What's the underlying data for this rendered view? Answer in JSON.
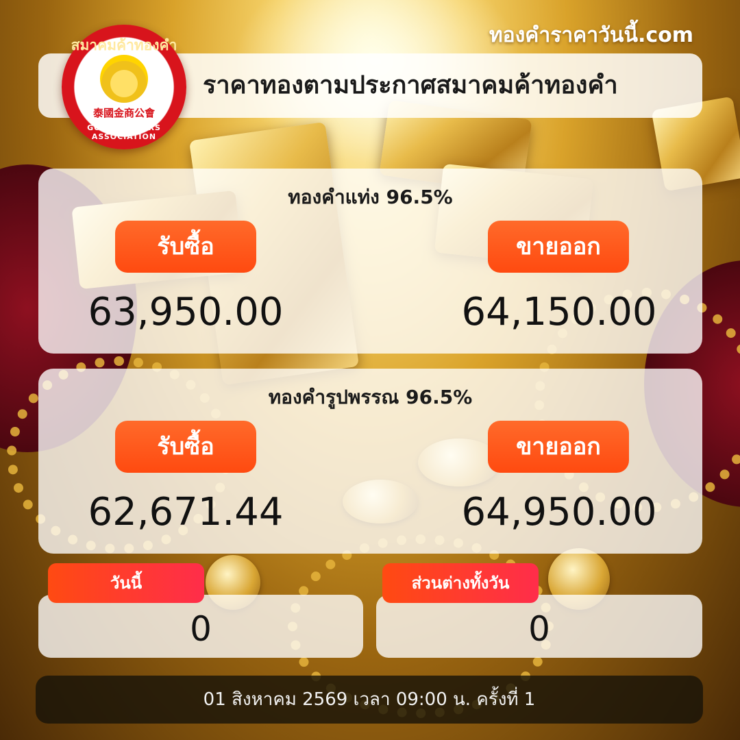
{
  "site_name": "ทองคำราคาวันนี้.com",
  "logo": {
    "ring_text_top": "สมาคมค้าทองคำ",
    "ring_text_chinese": "泰國金商公會",
    "ring_text_bottom": "GOLD TRADERS ASSOCIATION"
  },
  "title": "ราคาทองตามประกาศสมาคมค้าทองคำ",
  "gold_bar": {
    "heading": "ทองคำแท่ง 96.5%",
    "buy_label": "รับซื้อ",
    "sell_label": "ขายออก",
    "buy_price": "63,950.00",
    "sell_price": "64,150.00"
  },
  "gold_ornament": {
    "heading": "ทองคำรูปพรรณ 96.5%",
    "buy_label": "รับซื้อ",
    "sell_label": "ขายออก",
    "buy_price": "62,671.44",
    "sell_price": "64,950.00"
  },
  "today": {
    "label": "วันนี้",
    "value": "0"
  },
  "daily_diff": {
    "label": "ส่วนต่างทั้งวัน",
    "value": "0"
  },
  "footer": "01 สิงหาคม 2569 เวลา 09:00 น. ครั้งที่ 1",
  "colors": {
    "accent_orange": "#ff5518",
    "accent_red": "#ff2d4a",
    "logo_red": "#d8141c",
    "gold": "#e8bb4a"
  }
}
